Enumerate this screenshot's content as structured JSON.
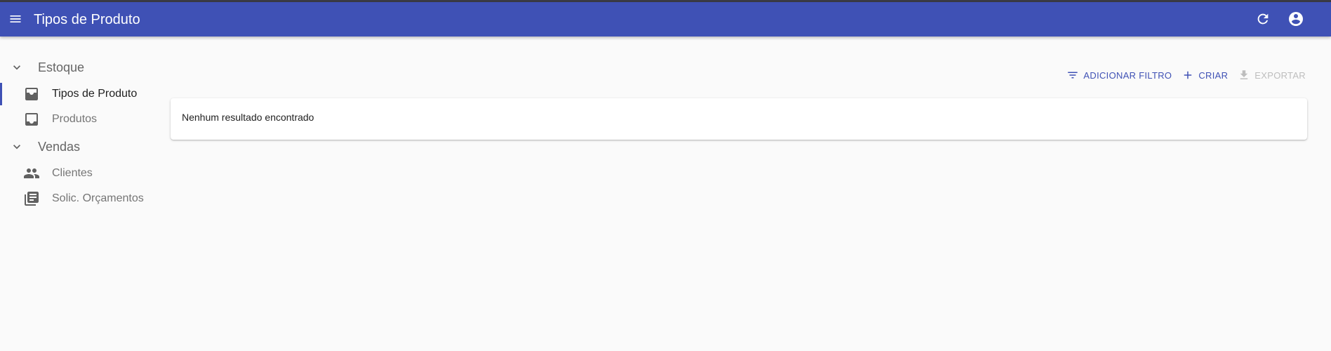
{
  "appbar": {
    "title": "Tipos de Produto",
    "menu_icon": "menu-icon",
    "refresh_icon": "refresh-icon",
    "account_icon": "account-circle-icon",
    "color": "#3f51b5"
  },
  "sidebar": {
    "sections": [
      {
        "label": "Estoque",
        "items": [
          {
            "label": "Tipos de Produto",
            "icon": "inbox-tray-icon",
            "active": true
          },
          {
            "label": "Produtos",
            "icon": "inbox-icon",
            "active": false
          }
        ]
      },
      {
        "label": "Vendas",
        "items": [
          {
            "label": "Clientes",
            "icon": "people-icon",
            "active": false
          },
          {
            "label": "Solic. Orçamentos",
            "icon": "library-books-icon",
            "active": false
          }
        ]
      }
    ]
  },
  "toolbar": {
    "filter_label": "ADICIONAR FILTRO",
    "create_label": "CRIAR",
    "export_label": "EXPORTAR"
  },
  "list": {
    "empty_message": "Nenhum resultado encontrado"
  }
}
